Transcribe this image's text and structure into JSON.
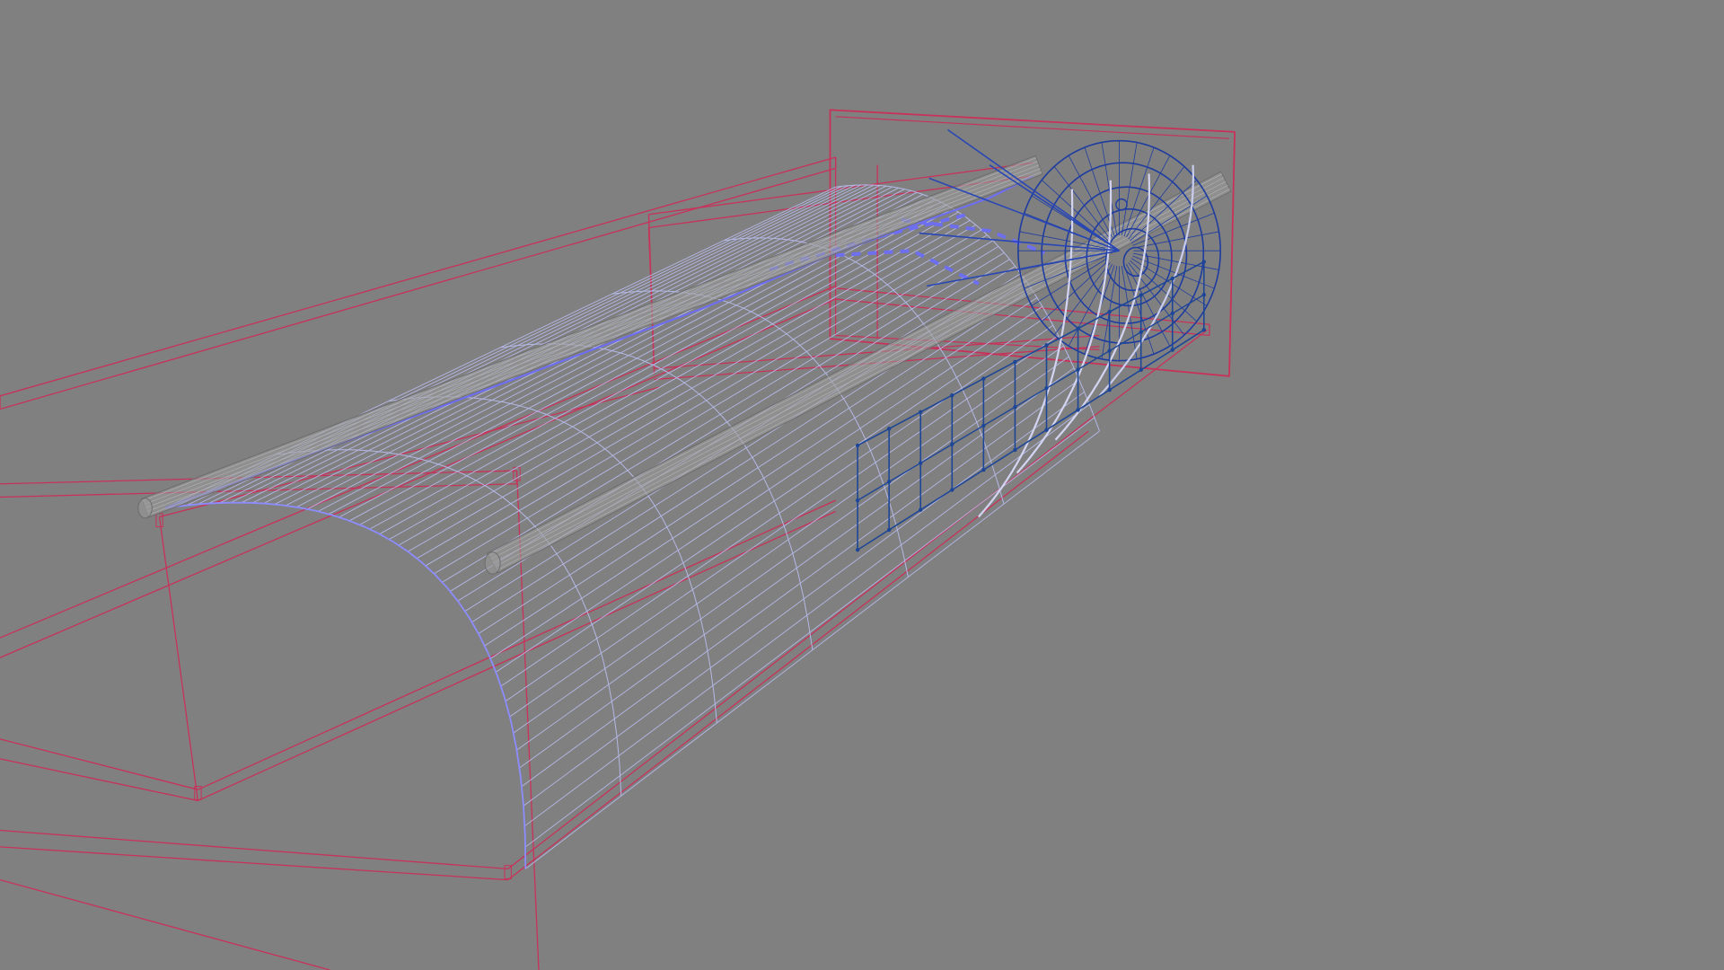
{
  "viewport": {
    "background_color": "#808080",
    "colors": {
      "bounding_box": "#c8325a",
      "tunnel_mesh": "#b4b8e6",
      "tunnel_edge": "#8c8cff",
      "tunnel_highlight": "#6e6ef0",
      "pipe": "#9a9a9a",
      "pipe_edge": "#6c6c6c",
      "helix": "#1e3ca0",
      "ladder": "#1e4696",
      "spoke": "#2846b4"
    },
    "objects": [
      {
        "name": "outer-bounding-box",
        "kind": "wireframe-box"
      },
      {
        "name": "inner-bounding-box",
        "kind": "wireframe-box"
      },
      {
        "name": "end-bounding-box",
        "kind": "wireframe-box"
      },
      {
        "name": "tunnel-shell",
        "kind": "curved-surface-mesh"
      },
      {
        "name": "pipe-top",
        "kind": "cylinder"
      },
      {
        "name": "pipe-middle",
        "kind": "cylinder"
      },
      {
        "name": "helix-coil",
        "kind": "spline"
      },
      {
        "name": "ladder-frame",
        "kind": "spline-grid"
      },
      {
        "name": "radial-spokes",
        "kind": "spline"
      }
    ]
  }
}
